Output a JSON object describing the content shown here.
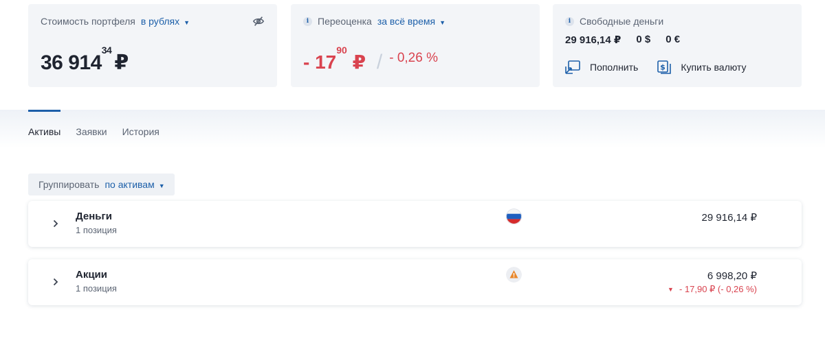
{
  "portfolio": {
    "title": "Стоимость портфеля",
    "currency_select": "в рублях",
    "value_int": "36 914",
    "value_frac": "34",
    "currency_sign": "₽"
  },
  "revaluation": {
    "title": "Переоценка",
    "period_select": "за всё время",
    "value_int": "- 17",
    "value_frac": "90",
    "currency_sign": "₽",
    "separator": "/",
    "percent": "- 0,26 %"
  },
  "free_cash": {
    "title": "Свободные деньги",
    "rub": "29 916,14 ₽",
    "usd": "0 $",
    "eur": "0 €",
    "topup_label": "Пополнить",
    "buy_currency_label": "Купить валюту"
  },
  "tabs": [
    {
      "label": "Активы",
      "active": true
    },
    {
      "label": "Заявки",
      "active": false
    },
    {
      "label": "История",
      "active": false
    }
  ],
  "group": {
    "label": "Группировать",
    "value": "по активам"
  },
  "assets": [
    {
      "title": "Деньги",
      "positions": "1 позиция",
      "value": "29 916,14 ₽",
      "flag": "russia-flag"
    },
    {
      "title": "Акции",
      "positions": "1 позиция",
      "value": "6 998,20 ₽",
      "change": "- 17,90 ₽ (- 0,26 %)",
      "flag": "warning-flag"
    }
  ],
  "colors": {
    "accent": "#1c5fa9",
    "negative": "#d9434f",
    "card_bg": "#f3f5f8"
  }
}
